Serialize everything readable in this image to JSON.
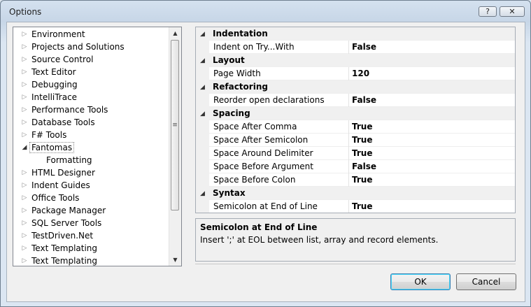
{
  "window": {
    "title": "Options",
    "help_label": "?",
    "close_label": "✕"
  },
  "tree": {
    "items": [
      {
        "label": "Environment",
        "level": 0,
        "expanded": false,
        "selected": false
      },
      {
        "label": "Projects and Solutions",
        "level": 0,
        "expanded": false,
        "selected": false
      },
      {
        "label": "Source Control",
        "level": 0,
        "expanded": false,
        "selected": false
      },
      {
        "label": "Text Editor",
        "level": 0,
        "expanded": false,
        "selected": false
      },
      {
        "label": "Debugging",
        "level": 0,
        "expanded": false,
        "selected": false
      },
      {
        "label": "IntelliTrace",
        "level": 0,
        "expanded": false,
        "selected": false
      },
      {
        "label": "Performance Tools",
        "level": 0,
        "expanded": false,
        "selected": false
      },
      {
        "label": "Database Tools",
        "level": 0,
        "expanded": false,
        "selected": false
      },
      {
        "label": "F# Tools",
        "level": 0,
        "expanded": false,
        "selected": false
      },
      {
        "label": "Fantomas",
        "level": 0,
        "expanded": true,
        "selected": true
      },
      {
        "label": "Formatting",
        "level": 1,
        "expanded": false,
        "selected": false
      },
      {
        "label": "HTML Designer",
        "level": 0,
        "expanded": false,
        "selected": false
      },
      {
        "label": "Indent Guides",
        "level": 0,
        "expanded": false,
        "selected": false
      },
      {
        "label": "Office Tools",
        "level": 0,
        "expanded": false,
        "selected": false
      },
      {
        "label": "Package Manager",
        "level": 0,
        "expanded": false,
        "selected": false
      },
      {
        "label": "SQL Server Tools",
        "level": 0,
        "expanded": false,
        "selected": false
      },
      {
        "label": "TestDriven.Net",
        "level": 0,
        "expanded": false,
        "selected": false
      },
      {
        "label": "Text Templating",
        "level": 0,
        "expanded": false,
        "selected": false
      },
      {
        "label": "Text Templating",
        "level": 0,
        "expanded": false,
        "selected": false
      }
    ]
  },
  "property_grid": {
    "rows": [
      {
        "type": "category",
        "label": "Indentation"
      },
      {
        "type": "property",
        "name": "Indent on Try...With",
        "value": "False"
      },
      {
        "type": "category",
        "label": "Layout"
      },
      {
        "type": "property",
        "name": "Page Width",
        "value": "120"
      },
      {
        "type": "category",
        "label": "Refactoring"
      },
      {
        "type": "property",
        "name": "Reorder open declarations",
        "value": "False"
      },
      {
        "type": "category",
        "label": "Spacing"
      },
      {
        "type": "property",
        "name": "Space After Comma",
        "value": "True"
      },
      {
        "type": "property",
        "name": "Space After Semicolon",
        "value": "True"
      },
      {
        "type": "property",
        "name": "Space Around Delimiter",
        "value": "True"
      },
      {
        "type": "property",
        "name": "Space Before Argument",
        "value": "False"
      },
      {
        "type": "property",
        "name": "Space Before Colon",
        "value": "True"
      },
      {
        "type": "category",
        "label": "Syntax"
      },
      {
        "type": "property",
        "name": "Semicolon at End of Line",
        "value": "True"
      }
    ]
  },
  "description": {
    "title": "Semicolon at End of Line",
    "text": "Insert ';' at EOL between list, array and record elements."
  },
  "buttons": {
    "ok": "OK",
    "cancel": "Cancel"
  }
}
